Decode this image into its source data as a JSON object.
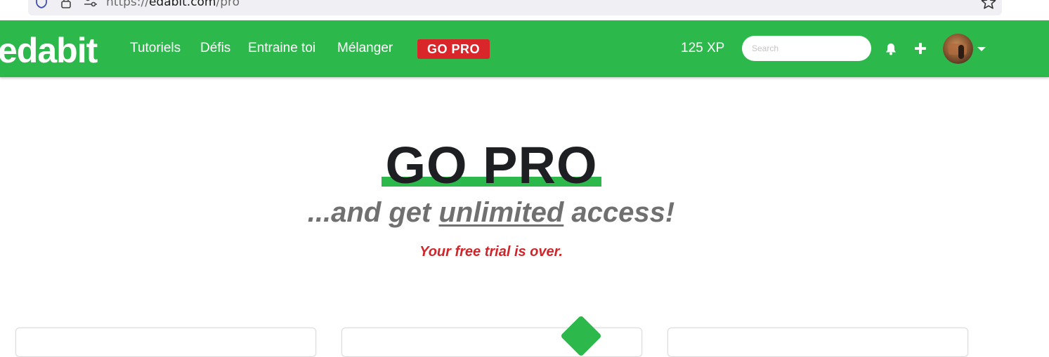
{
  "browser": {
    "url_prefix": "https://",
    "url_domain": "edabit.com",
    "url_path": "/pro"
  },
  "nav": {
    "logo": "edabit",
    "links": [
      "Tutoriels",
      "Défis",
      "Entraine toi",
      "Mélanger"
    ],
    "gopro_label": "GO PRO",
    "xp": "125 XP",
    "search_placeholder": "Search"
  },
  "hero": {
    "title": "GO PRO",
    "subtitle_before": "...and get ",
    "subtitle_emphasis": "unlimited",
    "subtitle_after": " access!",
    "trial_notice": "Your free trial is over."
  },
  "colors": {
    "brand_green": "#2db84b",
    "alert_red": "#d9262a",
    "title_dark": "#1e1f22",
    "subtitle_gray": "#707070"
  },
  "icons": {
    "shield": "shield-icon",
    "lock": "lock-icon",
    "permissions": "permissions-icon",
    "bookmark": "star-icon",
    "notifications": "bell-icon",
    "create": "plus-icon",
    "menu": "chevron-down-icon"
  }
}
